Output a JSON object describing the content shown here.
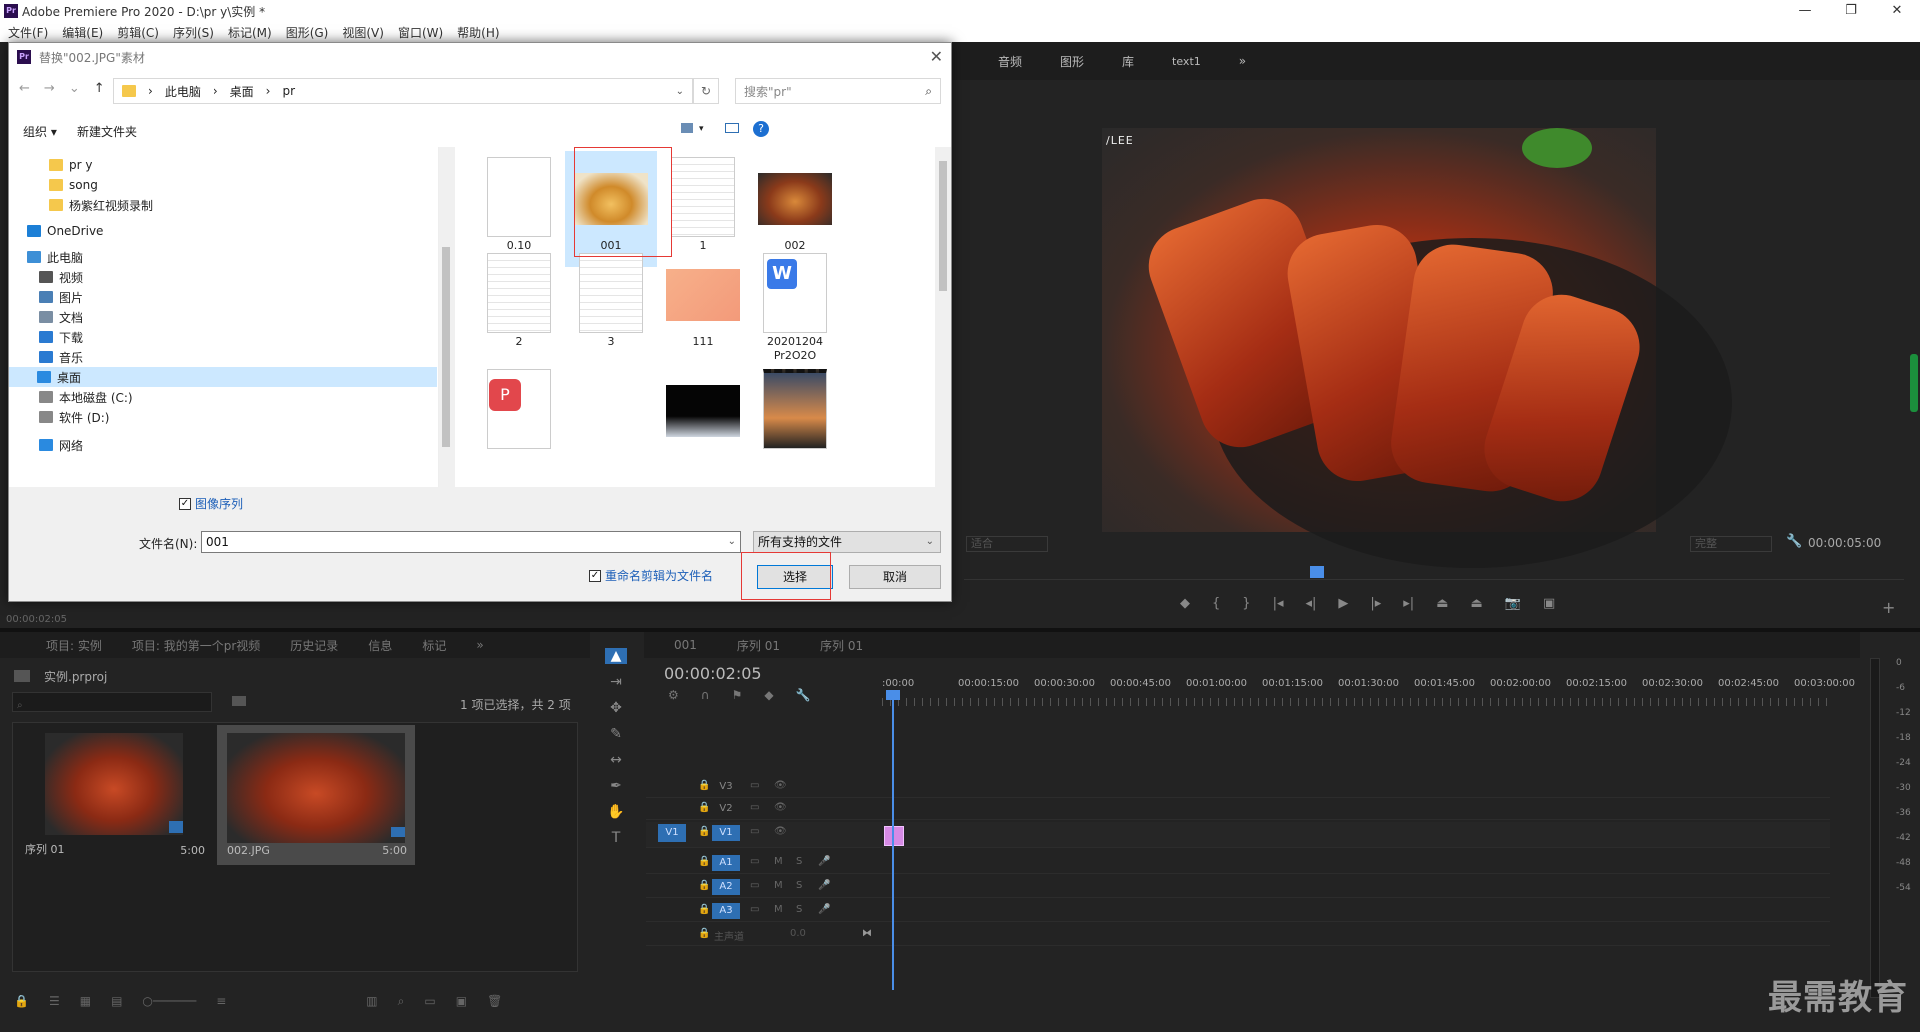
{
  "app": {
    "title": "Adobe Premiere Pro 2020 - D:\\pr y\\实例 *",
    "menu": [
      "文件(F)",
      "编辑(E)",
      "剪辑(C)",
      "序列(S)",
      "标记(M)",
      "图形(G)",
      "视图(V)",
      "窗口(W)",
      "帮助(H)"
    ]
  },
  "program_panel": {
    "tabs": [
      "音频",
      "图形",
      "库",
      "text1"
    ],
    "fit_dropdown": "适合",
    "quality_dropdown": "完整",
    "timecode": "00:00:05:00",
    "overlay_text": "/LEE"
  },
  "dialog": {
    "title": "替换\"002.JPG\"素材",
    "breadcrumb": [
      "此电脑",
      "桌面",
      "pr"
    ],
    "search_placeholder": "搜索\"pr\"",
    "organize": "组织 ▾",
    "new_folder": "新建文件夹",
    "tree": [
      {
        "label": "pr y",
        "icon": "folder-icon"
      },
      {
        "label": "song",
        "icon": "folder-icon"
      },
      {
        "label": "杨紫红视频录制",
        "icon": "folder-icon"
      },
      {
        "label": "OneDrive",
        "icon": "cloud-icon"
      },
      {
        "label": "此电脑",
        "icon": "computer-icon"
      },
      {
        "label": "视频",
        "icon": "video-icon"
      },
      {
        "label": "图片",
        "icon": "picture-icon"
      },
      {
        "label": "文档",
        "icon": "document-icon"
      },
      {
        "label": "下载",
        "icon": "download-icon"
      },
      {
        "label": "音乐",
        "icon": "music-icon"
      },
      {
        "label": "桌面",
        "icon": "desktop-icon"
      },
      {
        "label": "本地磁盘 (C:)",
        "icon": "drive-icon"
      },
      {
        "label": "软件 (D:)",
        "icon": "drive-icon"
      },
      {
        "label": "网络",
        "icon": "network-icon"
      }
    ],
    "files": [
      "0.10",
      "001",
      "1",
      "002",
      "2",
      "3",
      "111",
      "20201204\nPr2O2O",
      "",
      "",
      "",
      ""
    ],
    "image_sequence_label": "图像序列",
    "filename_label": "文件名(N):",
    "filename_value": "001",
    "filetype_value": "所有支持的文件",
    "rename_label": "重命名剪辑为文件名",
    "select_button": "选择",
    "cancel_button": "取消",
    "file_icons": [
      "blank-file-icon",
      "image-thumbnail-icon",
      "text-file-icon",
      "image-thumbnail-icon",
      "text-file-icon",
      "text-file-icon",
      "image-thumbnail-icon",
      "word-document-icon",
      "pdf-file-icon",
      "image-thumbnail-icon",
      "image-thumbnail-icon",
      "video-thumbnail-icon"
    ]
  },
  "source_timecode": "00:00:02:05",
  "project_panel": {
    "tabs": [
      "项目: 实例",
      "项目: 我的第一个pr视频",
      "历史记录",
      "信息",
      "标记"
    ],
    "project_name": "实例.prproj",
    "selection_count": "1 项已选择，共 2 项",
    "items": [
      {
        "label": "序列 01",
        "duration": "5:00"
      },
      {
        "label": "002.JPG",
        "duration": "5:00"
      }
    ]
  },
  "timeline": {
    "tabs": [
      "001",
      "序列 01",
      "序列 01"
    ],
    "timecode": "00:00:02:05",
    "ruler": [
      ":00:00",
      "00:00:15:00",
      "00:00:30:00",
      "00:00:45:00",
      "00:01:00:00",
      "00:01:15:00",
      "00:01:30:00",
      "00:01:45:00",
      "00:02:00:00",
      "00:02:15:00",
      "00:02:30:00",
      "00:02:45:00",
      "00:03:00:00"
    ],
    "tracks": [
      "V3",
      "V2",
      "V1",
      "A1",
      "A2",
      "A3"
    ],
    "source_patch_v": "V1",
    "master_label": "主声道",
    "master_value": "0.0"
  },
  "meters": [
    "0",
    "-6",
    "-12",
    "-18",
    "-24",
    "-30",
    "-36",
    "-42",
    "-48",
    "-54"
  ],
  "watermark": "最需教育",
  "colors": {
    "accent": "#2e6fb3",
    "highlight_red": "#e53935",
    "clip": "#d68ae5"
  }
}
